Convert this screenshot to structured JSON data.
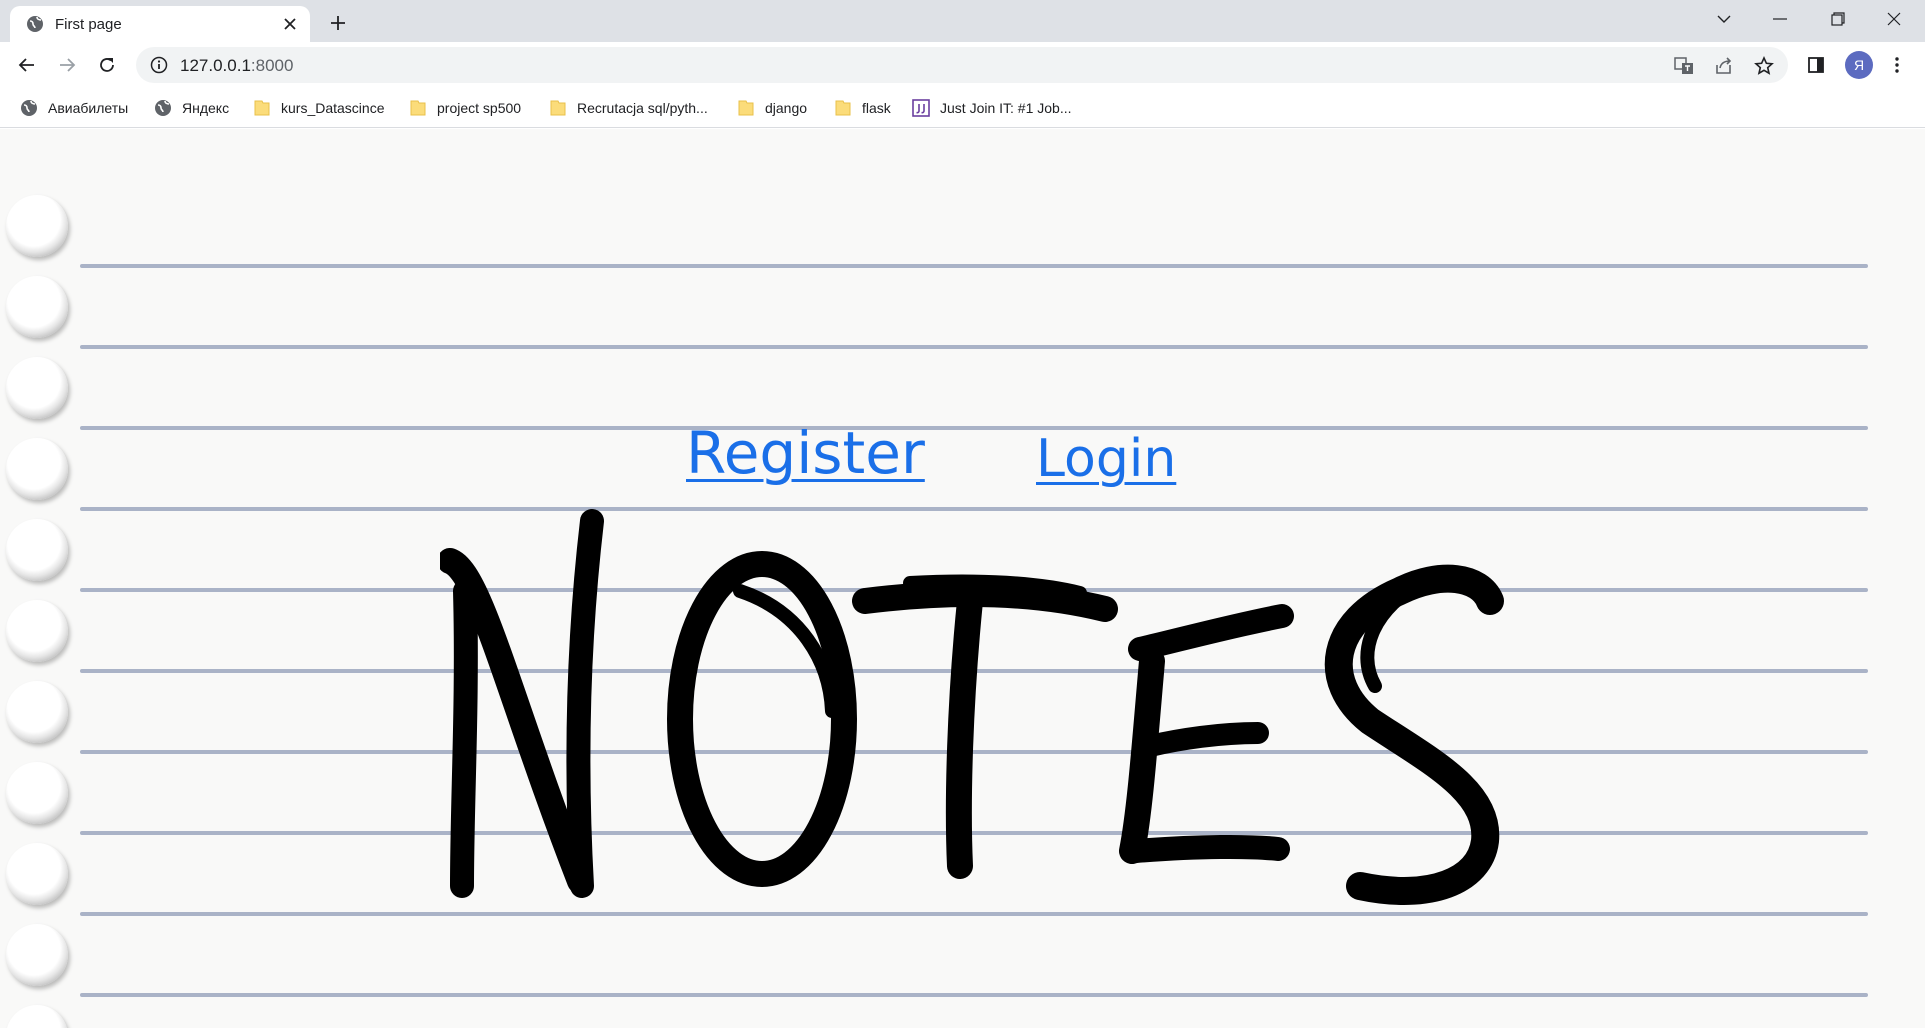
{
  "browser": {
    "tab": {
      "title": "First page"
    },
    "address": {
      "host": "127.0.0.1",
      "port": ":8000"
    },
    "profile_initial": "Я",
    "icons": [
      "globe-icon",
      "close-icon",
      "plus-icon",
      "chevron-down-icon",
      "minimize-icon",
      "restore-icon",
      "window-close-icon",
      "back-icon",
      "forward-icon",
      "reload-icon",
      "info-icon",
      "translate-icon",
      "share-icon",
      "star-icon",
      "side-panel-icon",
      "menu-icon",
      "folder-icon"
    ]
  },
  "bookmarks": [
    {
      "label": "Авиабилеты",
      "icon": "globe-icon"
    },
    {
      "label": "Яндекс",
      "icon": "globe-icon"
    },
    {
      "label": "kurs_Datascince",
      "icon": "folder-icon"
    },
    {
      "label": "project sp500",
      "icon": "folder-icon"
    },
    {
      "label": "Recrutacja sql/pyth...",
      "icon": "folder-icon"
    },
    {
      "label": "django",
      "icon": "folder-icon"
    },
    {
      "label": "flask",
      "icon": "folder-icon"
    },
    {
      "label": "Just Join IT: #1 Job...",
      "icon": "jj-icon"
    }
  ],
  "page": {
    "register_label": "Register",
    "login_label": "Login",
    "logo_text": "NOTES",
    "colors": {
      "link": "#1a6fe8",
      "paper": "#f9f9f8",
      "rule": "#aab3c7",
      "ink": "#000000"
    }
  }
}
